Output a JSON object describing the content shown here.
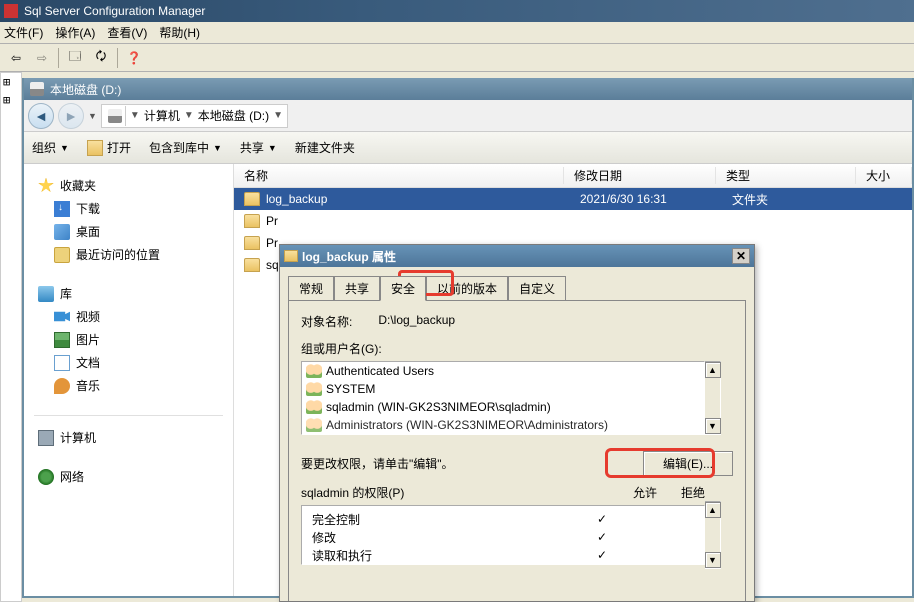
{
  "sqlmgr": {
    "title": "Sql Server Configuration Manager",
    "menu": {
      "file": "文件(F)",
      "action": "操作(A)",
      "view": "查看(V)",
      "help": "帮助(H)"
    }
  },
  "explorer": {
    "title": "本地磁盘 (D:)",
    "breadcrumb": {
      "computer": "计算机",
      "drive": "本地磁盘 (D:)"
    },
    "toolbar": {
      "organize": "组织",
      "open": "打开",
      "includeInLibrary": "包含到库中",
      "share": "共享",
      "newFolder": "新建文件夹"
    },
    "sidebar": {
      "favorites": "收藏夹",
      "downloads": "下载",
      "desktop": "桌面",
      "recent": "最近访问的位置",
      "libraries": "库",
      "videos": "视频",
      "pictures": "图片",
      "documents": "文档",
      "music": "音乐",
      "computer": "计算机",
      "network": "网络"
    },
    "columns": {
      "name": "名称",
      "date": "修改日期",
      "type": "类型",
      "size": "大小"
    },
    "rows": [
      {
        "name": "log_backup",
        "date": "2021/6/30 16:31",
        "type": "文件夹"
      },
      {
        "name": "Pr",
        "date": "",
        "type": ""
      },
      {
        "name": "Pr",
        "date": "",
        "type": ""
      },
      {
        "name": "sq",
        "date": "",
        "type": ""
      }
    ]
  },
  "dialog": {
    "title": "log_backup 属性",
    "tabs": {
      "general": "常规",
      "sharing": "共享",
      "security": "安全",
      "previous": "以前的版本",
      "custom": "自定义"
    },
    "objectLabel": "对象名称:",
    "objectValue": "D:\\log_backup",
    "groupLabel": "组或用户名(G):",
    "groups": [
      "Authenticated Users",
      "SYSTEM",
      "sqladmin (WIN-GK2S3NIMEOR\\sqladmin)",
      "Administrators (WIN-GK2S3NIMEOR\\Administrators)"
    ],
    "editHint": "要更改权限，请单击\"编辑\"。",
    "editBtn": "编辑(E)...",
    "permLabel": "sqladmin 的权限(P)",
    "allow": "允许",
    "deny": "拒绝",
    "perms": [
      {
        "name": "完全控制",
        "allow": "✓",
        "deny": ""
      },
      {
        "name": "修改",
        "allow": "✓",
        "deny": ""
      },
      {
        "name": "读取和执行",
        "allow": "✓",
        "deny": ""
      }
    ]
  }
}
